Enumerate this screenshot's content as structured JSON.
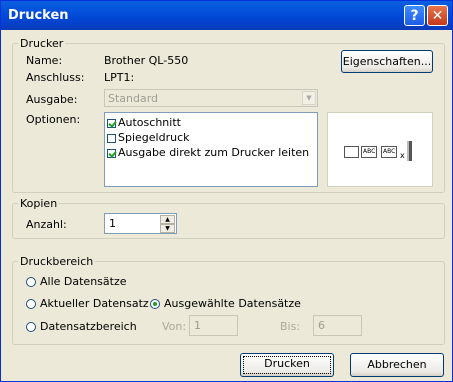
{
  "window": {
    "title": "Drucken",
    "help_glyph": "?",
    "close_glyph": "✕"
  },
  "drucker": {
    "legend": "Drucker",
    "name_label": "Name:",
    "name_value": "Brother QL-550",
    "port_label": "Anschluss:",
    "port_value": "LPT1:",
    "properties_button": "Eigenschaften...",
    "output_label": "Ausgabe:",
    "output_value": "Standard",
    "options_label": "Optionen:",
    "options": [
      {
        "label": "Autoschnitt",
        "checked": true
      },
      {
        "label": "Spiegeldruck",
        "checked": false
      },
      {
        "label": "Ausgabe direkt zum Drucker leiten",
        "checked": true
      }
    ],
    "preview_text_1": "ABC",
    "preview_text_2": "ABC",
    "preview_text_3": "x"
  },
  "kopien": {
    "legend": "Kopien",
    "count_label": "Anzahl:",
    "count_value": "1"
  },
  "druckbereich": {
    "legend": "Druckbereich",
    "all_records": "Alle Datensätze",
    "current_record": "Aktueller Datensatz",
    "selected_records": "Ausgewählte Datensätze",
    "record_range": "Datensatzbereich",
    "from_label": "Von:",
    "from_value": "1",
    "to_label": "Bis:",
    "to_value": "6"
  },
  "buttons": {
    "print": "Drucken",
    "cancel": "Abbrechen"
  }
}
